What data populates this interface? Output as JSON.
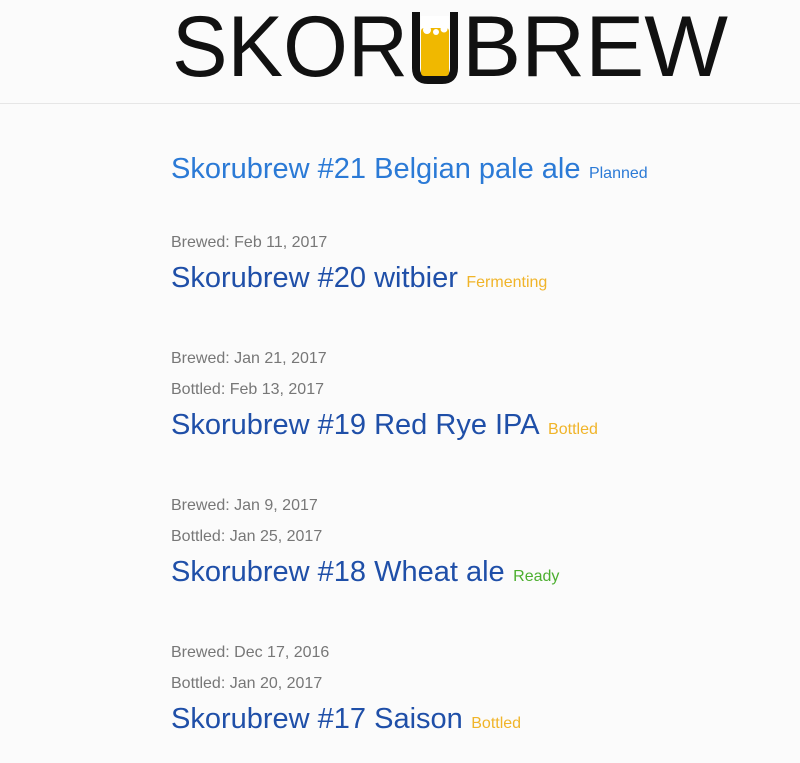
{
  "brand": {
    "logo_text_left": "SKOR",
    "logo_text_right": "BREW",
    "logo_alt": "SKORUBREW",
    "beer_color": "#f0b800"
  },
  "brews": [
    {
      "title": "Skorubrew #21 Belgian pale ale",
      "status": "Planned",
      "status_color": "#2b7ad6",
      "brewed": "",
      "bottled": ""
    },
    {
      "title": "Skorubrew #20 witbier",
      "status": "Fermenting",
      "status_color": "#f0b429",
      "brewed": "Brewed: Feb 11, 2017",
      "bottled": ""
    },
    {
      "title": "Skorubrew #19 Red Rye IPA",
      "status": "Bottled",
      "status_color": "#f0b429",
      "brewed": "Brewed: Jan 21, 2017",
      "bottled": "Bottled: Feb 13, 2017"
    },
    {
      "title": "Skorubrew #18 Wheat ale",
      "status": "Ready",
      "status_color": "#4caf2f",
      "brewed": "Brewed: Jan 9, 2017",
      "bottled": "Bottled: Jan 25, 2017"
    },
    {
      "title": "Skorubrew #17 Saison",
      "status": "Bottled",
      "status_color": "#f0b429",
      "brewed": "Brewed: Dec 17, 2016",
      "bottled": "Bottled: Jan 20, 2017"
    }
  ]
}
